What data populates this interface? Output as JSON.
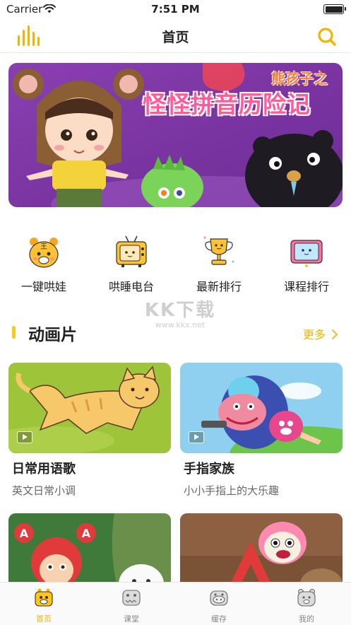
{
  "status": {
    "carrier": "Carrier",
    "time": "7:51 PM"
  },
  "nav": {
    "title": "首页"
  },
  "banner": {
    "title": "怪怪拼音历险记",
    "subtitle": "熊孩子之"
  },
  "quick": [
    {
      "label": "一键哄娃",
      "icon": "tiger-icon"
    },
    {
      "label": "哄睡电台",
      "icon": "tv-icon"
    },
    {
      "label": "最新排行",
      "icon": "trophy-icon"
    },
    {
      "label": "课程排行",
      "icon": "tablet-icon"
    }
  ],
  "watermark": {
    "main": "KK下载",
    "url": "www.kkx.net"
  },
  "section": {
    "title": "动画片",
    "more": "更多",
    "more_icon": "chevron-right-icon"
  },
  "cards": [
    {
      "name": "日常用语歌",
      "desc": "英文日常小调"
    },
    {
      "name": "手指家族",
      "desc": "小小手指上的大乐趣"
    },
    {
      "name": "",
      "desc": ""
    },
    {
      "name": "",
      "desc": ""
    }
  ],
  "tabs": [
    {
      "label": "首页",
      "active": true
    },
    {
      "label": "课堂"
    },
    {
      "label": "缓存"
    },
    {
      "label": "我的"
    }
  ],
  "colors": {
    "accent": "#f5b300",
    "accent_light": "#ffc61a"
  }
}
